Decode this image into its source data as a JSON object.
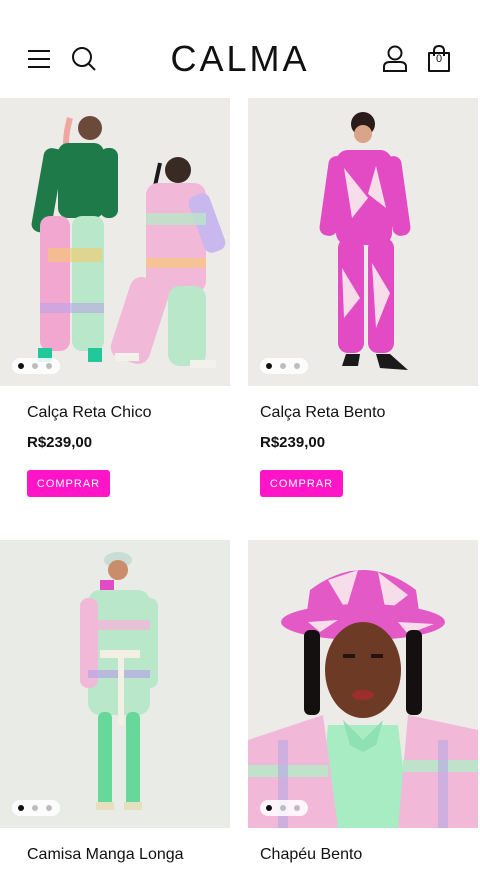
{
  "header": {
    "logo": "CALMA",
    "cart_count": "0",
    "icons": [
      "menu-icon",
      "search-icon",
      "account-icon",
      "shopping-bag-icon"
    ]
  },
  "products": [
    {
      "name": "Calça Reta Chico",
      "price": "R$239,00",
      "buy_label": "COMPRAR",
      "image_count": 3,
      "active_image": 1
    },
    {
      "name": "Calça Reta Bento",
      "price": "R$239,00",
      "buy_label": "COMPRAR",
      "image_count": 3,
      "active_image": 1
    },
    {
      "name": "Camisa Manga Longa",
      "image_count": 3,
      "active_image": 1
    },
    {
      "name": "Chapéu Bento",
      "image_count": 3,
      "active_image": 1
    }
  ],
  "colors": {
    "accent": "#ff14c8",
    "text": "#111111",
    "photo_bg": "#ececea"
  }
}
